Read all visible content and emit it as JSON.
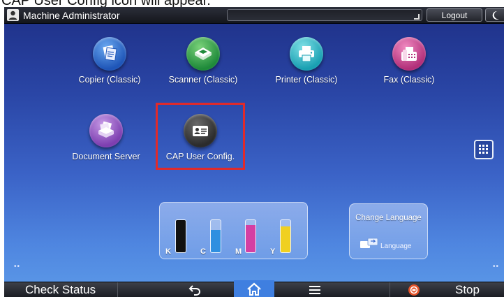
{
  "caption": {
    "text": "CAP User Config icon will appear."
  },
  "topbar": {
    "user_label": "Machine Administrator",
    "logout_label": "Logout"
  },
  "apps": [
    {
      "label": "Copier (Classic)",
      "icon": "copier-icon",
      "color": "#2a6ad0"
    },
    {
      "label": "Scanner (Classic)",
      "icon": "scanner-icon",
      "color": "#2a9a45"
    },
    {
      "label": "Printer (Classic)",
      "icon": "printer-icon",
      "color": "#22a9bb"
    },
    {
      "label": "Fax (Classic)",
      "icon": "fax-icon",
      "color": "#c03c86"
    },
    {
      "label": "Document Server",
      "icon": "document-server-icon",
      "color": "#8a4bbb"
    },
    {
      "label": "CAP User Config.",
      "icon": "id-card-icon",
      "color": "#333333"
    }
  ],
  "highlight_color": "#e12a2a",
  "toner": [
    {
      "letter": "K",
      "level": 1.0,
      "color": "#111111"
    },
    {
      "letter": "C",
      "level": 0.7,
      "color": "#2f8fe0"
    },
    {
      "letter": "M",
      "level": 0.85,
      "color": "#d43fa3"
    },
    {
      "letter": "Y",
      "level": 0.8,
      "color": "#f0d020"
    }
  ],
  "language": {
    "title": "Change Language",
    "sub_label": "Language"
  },
  "bottombar": {
    "check_status_label": "Check Status",
    "stop_label": "Stop"
  }
}
